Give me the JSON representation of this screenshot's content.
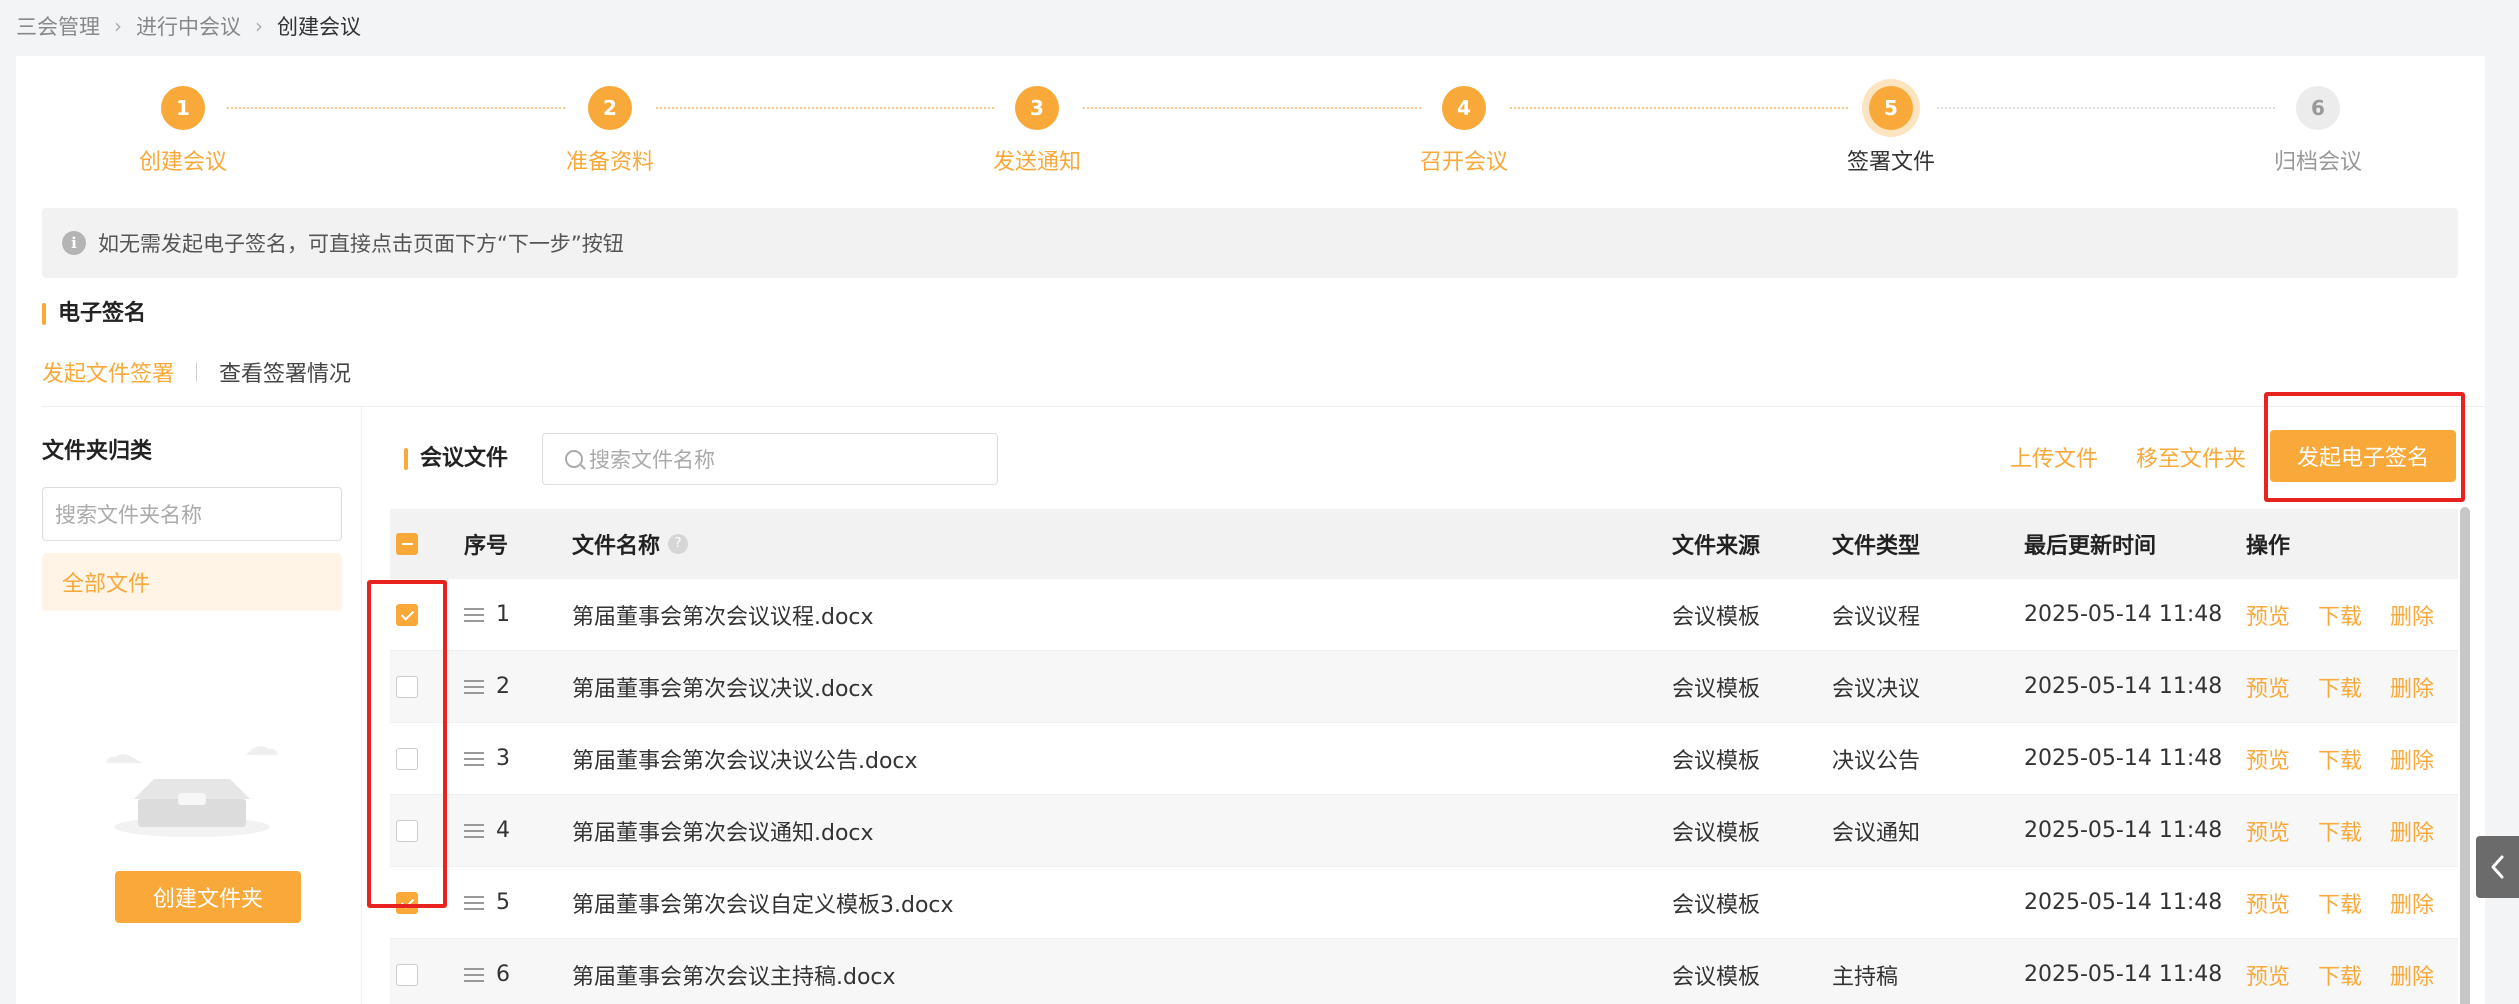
{
  "breadcrumb": [
    "三会管理",
    "进行中会议",
    "创建会议"
  ],
  "steps": [
    {
      "num": "1",
      "label": "创建会议"
    },
    {
      "num": "2",
      "label": "准备资料"
    },
    {
      "num": "3",
      "label": "发送通知"
    },
    {
      "num": "4",
      "label": "召开会议"
    },
    {
      "num": "5",
      "label": "签署文件"
    },
    {
      "num": "6",
      "label": "归档会议"
    }
  ],
  "alert": {
    "text": "如无需发起电子签名，可直接点击页面下方“下一步”按钮"
  },
  "section": {
    "title": "电子签名"
  },
  "subtabs": {
    "start": "发起文件签署",
    "view": "查看签署情况"
  },
  "folder_panel": {
    "title": "文件夹归类",
    "search_placeholder": "搜索文件夹名称",
    "all_files": "全部文件",
    "create_button": "创建文件夹"
  },
  "file_panel": {
    "title": "会议文件",
    "search_placeholder": "搜索文件名称",
    "upload": "上传文件",
    "move": "移至文件夹",
    "sign_button": "发起电子签名"
  },
  "table": {
    "headers": {
      "seq": "序号",
      "name": "文件名称",
      "help": "?",
      "source": "文件来源",
      "type": "文件类型",
      "updated": "最后更新时间",
      "actions": "操作"
    },
    "rows": [
      {
        "checked": true,
        "seq": "1",
        "name": "第届董事会第次会议议程.docx",
        "source": "会议模板",
        "type": "会议议程",
        "updated": "2025-05-14 11:48"
      },
      {
        "checked": false,
        "seq": "2",
        "name": "第届董事会第次会议决议.docx",
        "source": "会议模板",
        "type": "会议决议",
        "updated": "2025-05-14 11:48"
      },
      {
        "checked": false,
        "seq": "3",
        "name": "第届董事会第次会议决议公告.docx",
        "source": "会议模板",
        "type": "决议公告",
        "updated": "2025-05-14 11:48"
      },
      {
        "checked": false,
        "seq": "4",
        "name": "第届董事会第次会议通知.docx",
        "source": "会议模板",
        "type": "会议通知",
        "updated": "2025-05-14 11:48"
      },
      {
        "checked": true,
        "seq": "5",
        "name": "第届董事会第次会议自定义模板3.docx",
        "source": "会议模板",
        "type": "",
        "updated": "2025-05-14 11:48"
      },
      {
        "checked": false,
        "seq": "6",
        "name": "第届董事会第次会议主持稿.docx",
        "source": "会议模板",
        "type": "主持稿",
        "updated": "2025-05-14 11:48"
      }
    ],
    "actions": {
      "preview": "预览",
      "download": "下载",
      "delete": "删除"
    }
  },
  "colors": {
    "accent": "#f9a93a",
    "highlight": "#e8231f"
  }
}
